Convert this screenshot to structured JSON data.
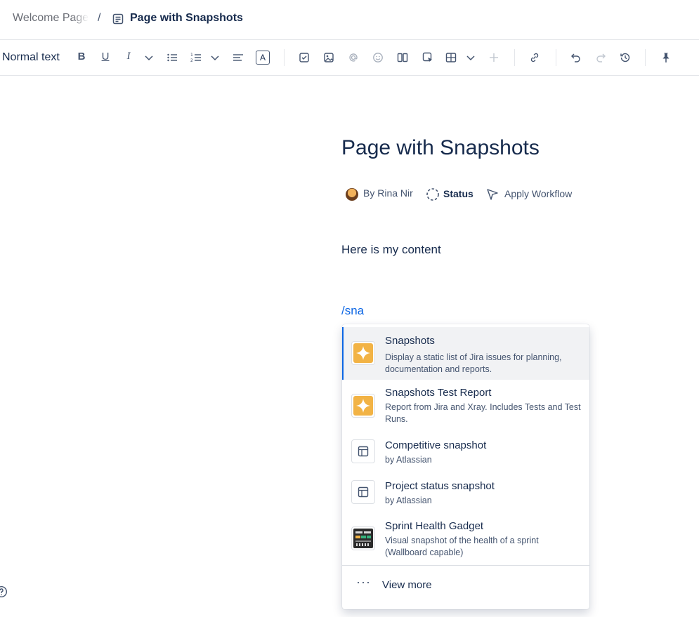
{
  "breadcrumb": {
    "first": "Welcome Page",
    "separator": "/",
    "current": "Page with Snapshots"
  },
  "toolbar": {
    "text_style": "Normal text",
    "bold": "B",
    "underline": "U",
    "italic": "I",
    "text_color": "A",
    "icons": [
      "bold-icon",
      "underline-icon",
      "italic-icon",
      "chevron-down-icon",
      "bullet-list-icon",
      "numbered-list-icon",
      "chevron-down-icon",
      "align-icon",
      "text-color-icon",
      "task-icon",
      "image-icon",
      "mention-icon",
      "emoji-icon",
      "layout-icon",
      "insert-macro-icon",
      "table-icon",
      "chevron-down-icon",
      "plus-icon",
      "link-icon",
      "undo-icon",
      "redo-icon",
      "history-icon",
      "pin-icon"
    ]
  },
  "page": {
    "title": "Page with Snapshots",
    "byline": {
      "author": "By Rina Nir",
      "status": "Status",
      "workflow": "Apply Workflow"
    },
    "content": "Here is my content",
    "slash_command": "/sna"
  },
  "slash_menu": {
    "items": [
      {
        "title": "Snapshots",
        "description": "Display a static list of Jira issues for planning, documentation and reports.",
        "icon": "snapshots-app-icon",
        "selected": true
      },
      {
        "title": "Snapshots Test Report",
        "description": "Report from Jira and Xray. Includes Tests and Test Runs.",
        "icon": "snapshots-app-icon",
        "selected": false
      },
      {
        "title": "Competitive snapshot",
        "description": "by Atlassian",
        "icon": "template-icon",
        "selected": false
      },
      {
        "title": "Project status snapshot",
        "description": "by Atlassian",
        "icon": "template-icon",
        "selected": false
      },
      {
        "title": "Sprint Health Gadget",
        "description": "Visual snapshot of the health of a sprint (Wallboard capable)",
        "icon": "dashboard-gadget-icon",
        "selected": false
      }
    ],
    "view_more": "View more"
  },
  "colors": {
    "accent": "#0c66e4",
    "snapshots_icon": "#f2b345",
    "text": "#172b4d",
    "subtle_text": "#44546f"
  }
}
